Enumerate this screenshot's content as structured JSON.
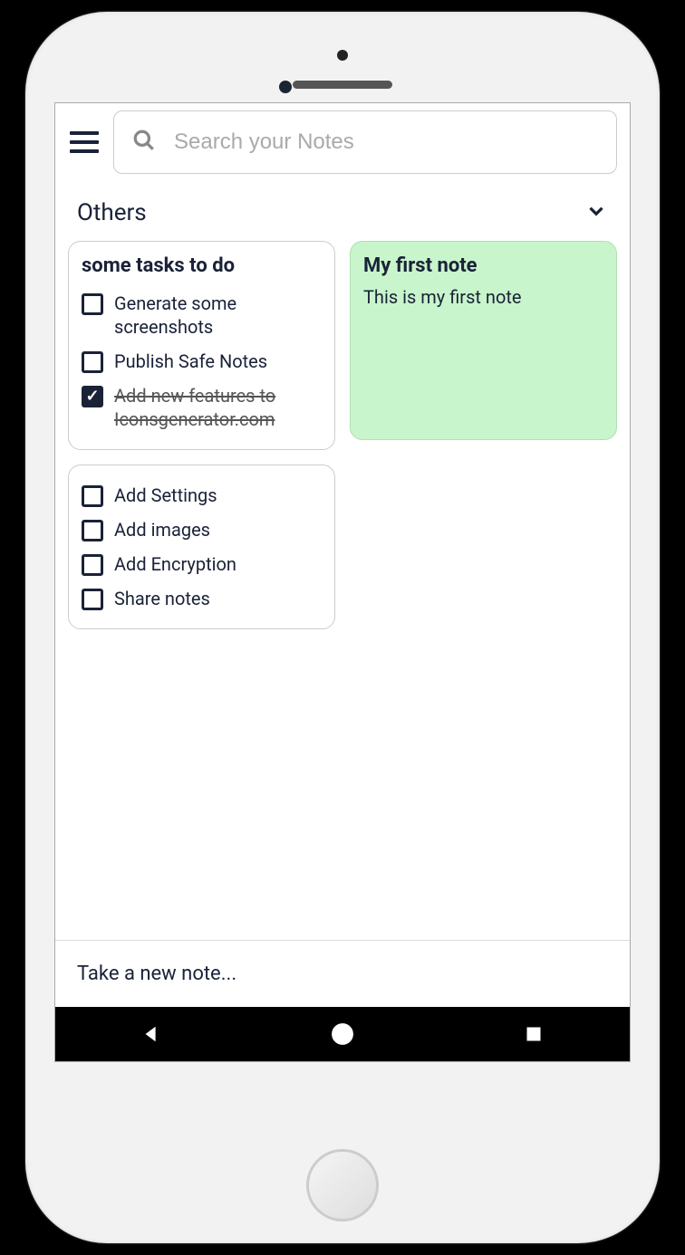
{
  "search": {
    "placeholder": "Search your Notes"
  },
  "section": {
    "title": "Others"
  },
  "notes": [
    {
      "title": "some tasks to do",
      "tasks": [
        {
          "text": "Generate some screenshots",
          "done": false
        },
        {
          "text": "Publish Safe Notes",
          "done": false
        },
        {
          "text": "Add new features to Iconsgenerator.com",
          "done": true
        }
      ]
    },
    {
      "title": "My first note",
      "body": "This is my first note"
    },
    {
      "tasks": [
        {
          "text": "Add Settings",
          "done": false
        },
        {
          "text": "Add images",
          "done": false
        },
        {
          "text": "Add Encryption",
          "done": false
        },
        {
          "text": "Share notes",
          "done": false
        }
      ]
    }
  ],
  "newNote": {
    "placeholder": "Take a new note..."
  }
}
